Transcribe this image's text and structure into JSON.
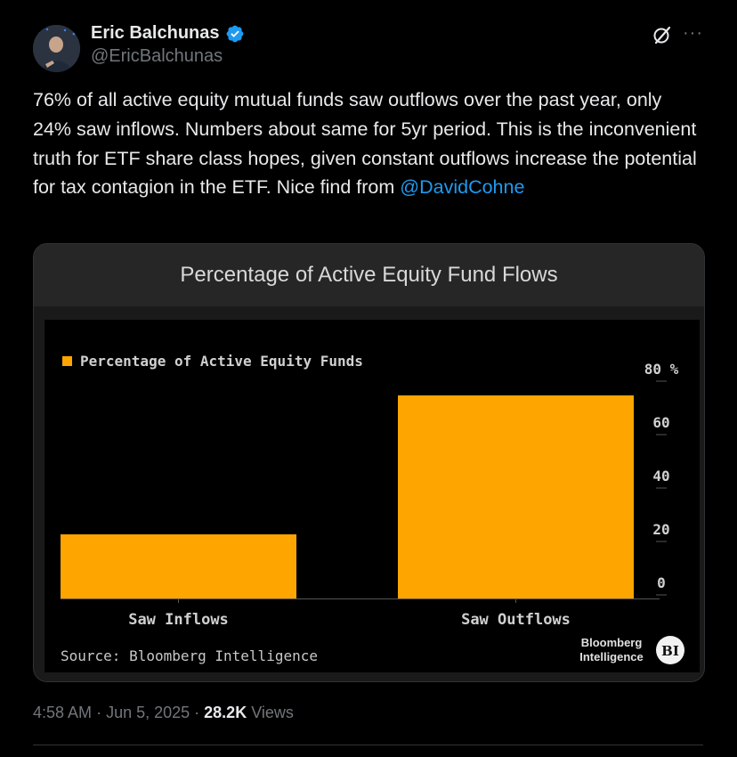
{
  "author": {
    "name": "Eric Balchunas",
    "handle": "@EricBalchunas",
    "verified": true
  },
  "tweet": {
    "text": "76% of all active equity mutual funds saw outflows over the past year, only 24% saw inflows. Numbers about same for 5yr period. This is the inconvenient truth for ETF share class hopes, given constant outflows increase the potential for tax contagion in the ETF. Nice find from ",
    "mention": "@DavidCohne"
  },
  "meta": {
    "time": "4:58 AM",
    "date": "Jun 5, 2025",
    "views_count": "28.2K",
    "views_label": "Views"
  },
  "colors": {
    "accent": "#1d9bf0",
    "bar": "#ffa500",
    "background": "#000000"
  },
  "chart_data": {
    "type": "bar",
    "title": "Percentage of Active Equity Fund Flows",
    "categories": [
      "Saw Inflows",
      "Saw Outflows"
    ],
    "series": [
      {
        "name": "Percentage of Active Equity Funds",
        "values": [
          24,
          76
        ]
      }
    ],
    "ylim": [
      0,
      80
    ],
    "yticks": [
      "0",
      "20",
      "40",
      "60",
      "80 %"
    ],
    "y_axis_position": "right",
    "legend": "top-left",
    "grid": false,
    "source": "Source: Bloomberg Intelligence",
    "brand": "Bloomberg Intelligence",
    "brand_lines": [
      "Bloomberg",
      "Intelligence"
    ],
    "brand_badge": "BI"
  }
}
